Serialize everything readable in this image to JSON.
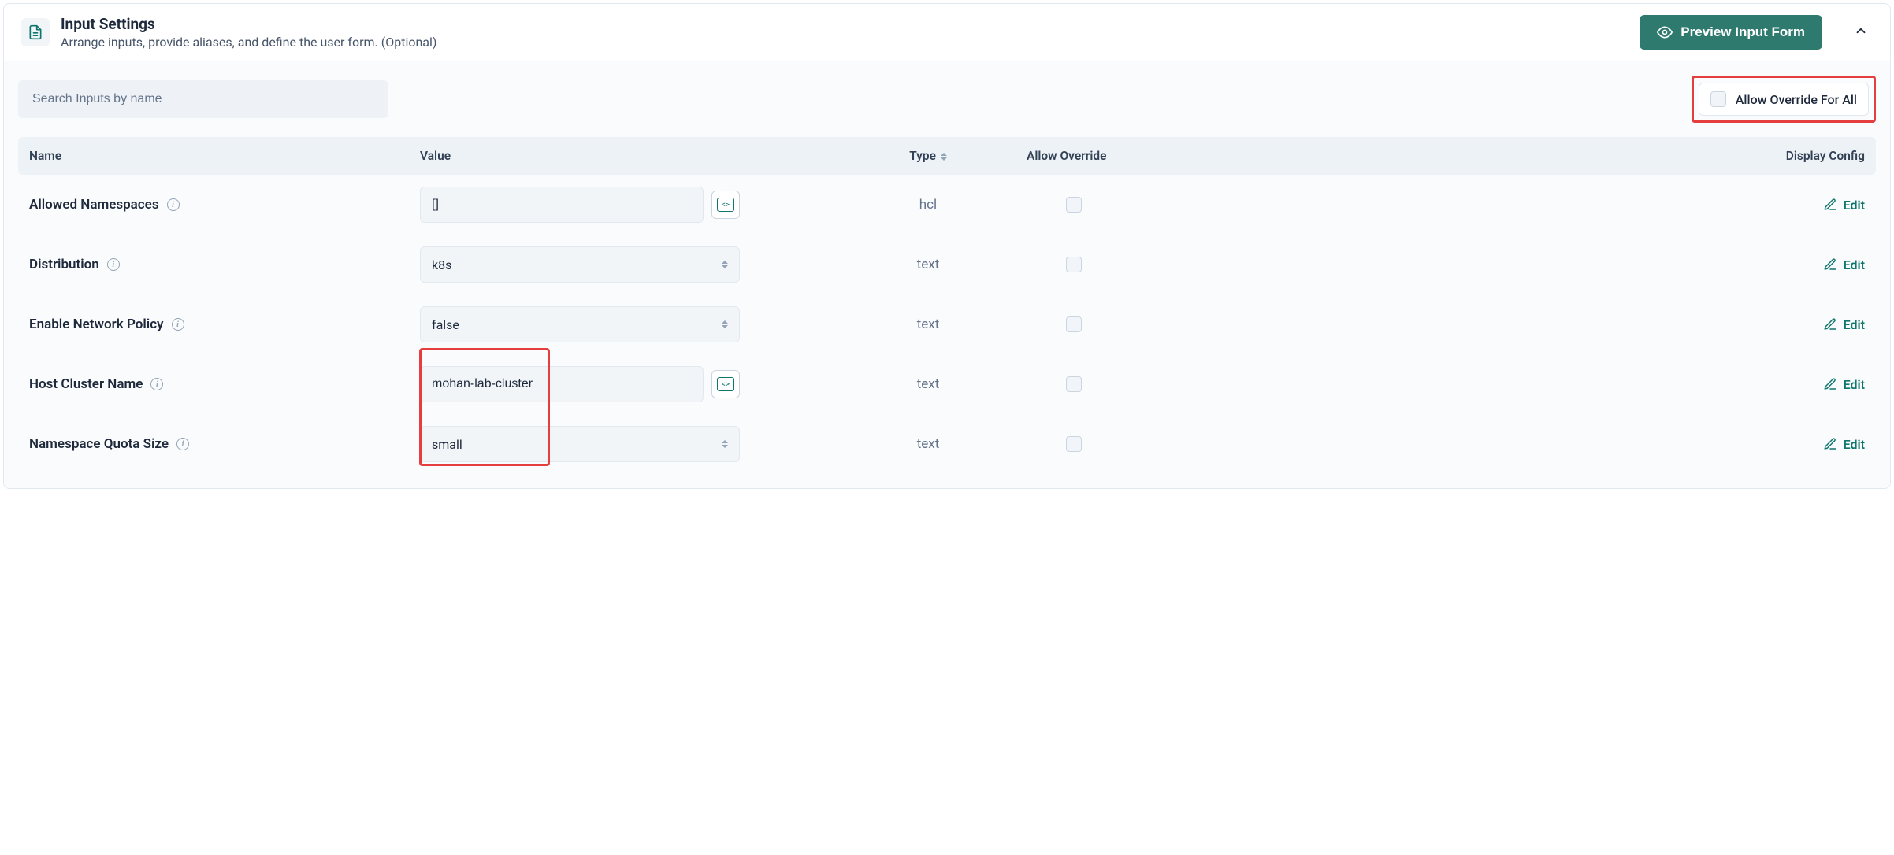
{
  "header": {
    "title": "Input Settings",
    "subtitle": "Arrange inputs, provide aliases, and define the user form. (Optional)",
    "preview_button": "Preview Input Form"
  },
  "toolbar": {
    "search_placeholder": "Search Inputs by name",
    "override_all_label": "Allow Override For All"
  },
  "columns": {
    "name": "Name",
    "value": "Value",
    "type": "Type",
    "override": "Allow Override",
    "config": "Display Config"
  },
  "edit_label": "Edit",
  "rows": [
    {
      "name": "Allowed Namespaces",
      "value": "[]",
      "type": "hcl",
      "control": "text_code"
    },
    {
      "name": "Distribution",
      "value": "k8s",
      "type": "text",
      "control": "dropdown"
    },
    {
      "name": "Enable Network Policy",
      "value": "false",
      "type": "text",
      "control": "dropdown"
    },
    {
      "name": "Host Cluster Name",
      "value": "mohan-lab-cluster",
      "type": "text",
      "control": "text_code"
    },
    {
      "name": "Namespace Quota Size",
      "value": "small",
      "type": "text",
      "control": "dropdown"
    }
  ]
}
